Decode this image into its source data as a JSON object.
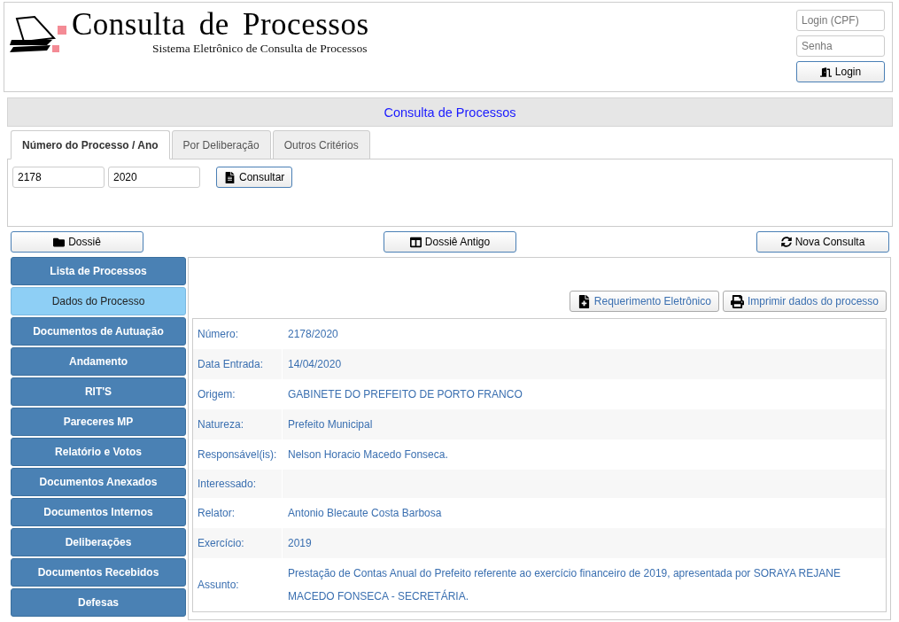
{
  "header": {
    "title": "Consulta de Processos",
    "subtitle": "Sistema Eletrônico de Consulta de Processos",
    "login_placeholder": "Login (CPF)",
    "password_placeholder": "Senha",
    "login_button": "Login"
  },
  "section_title": "Consulta de Processos",
  "tabs": [
    {
      "label": "Número do Processo / Ano",
      "selected": true
    },
    {
      "label": "Por Deliberação",
      "selected": false
    },
    {
      "label": "Outros Critérios",
      "selected": false
    }
  ],
  "search": {
    "number": "2178",
    "year": "2020",
    "button": "Consultar"
  },
  "actions": {
    "dossie": "Dossiê",
    "dossie_antigo": "Dossiê Antigo",
    "nova_consulta": "Nova Consulta"
  },
  "sidebar": {
    "items": [
      {
        "label": "Lista de Processos",
        "selected": false
      },
      {
        "label": "Dados do Processo",
        "selected": true
      },
      {
        "label": "Documentos de Autuação",
        "selected": false
      },
      {
        "label": "Andamento",
        "selected": false
      },
      {
        "label": "RIT'S",
        "selected": false
      },
      {
        "label": "Pareceres MP",
        "selected": false
      },
      {
        "label": "Relatório e Votos",
        "selected": false
      },
      {
        "label": "Documentos Anexados",
        "selected": false
      },
      {
        "label": "Documentos Internos",
        "selected": false
      },
      {
        "label": "Deliberações",
        "selected": false
      },
      {
        "label": "Documentos Recebidos",
        "selected": false
      },
      {
        "label": "Defesas",
        "selected": false
      }
    ]
  },
  "content_buttons": [
    "Requerimento Eletrônico",
    "Imprimir dados do processo"
  ],
  "details": [
    {
      "label": "Número:",
      "value": "2178/2020"
    },
    {
      "label": "Data Entrada:",
      "value": "14/04/2020"
    },
    {
      "label": "Origem:",
      "value": "GABINETE DO PREFEITO DE PORTO FRANCO"
    },
    {
      "label": "Natureza:",
      "value": "Prefeito Municipal"
    },
    {
      "label": "Responsável(is):",
      "value": "Nelson Horacio Macedo Fonseca."
    },
    {
      "label": "Interessado:"
    },
    {
      "label": "Relator:",
      "value": "Antonio Blecaute Costa Barbosa"
    },
    {
      "label": "Exercício:",
      "value": "2019"
    },
    {
      "label": "Assunto:",
      "value": "Prestação de Contas Anual do Prefeito referente ao exercício financeiro de 2019, apresentada por SORAYA REJANE MACEDO FONSECA - SECRETÁRIA."
    }
  ]
}
